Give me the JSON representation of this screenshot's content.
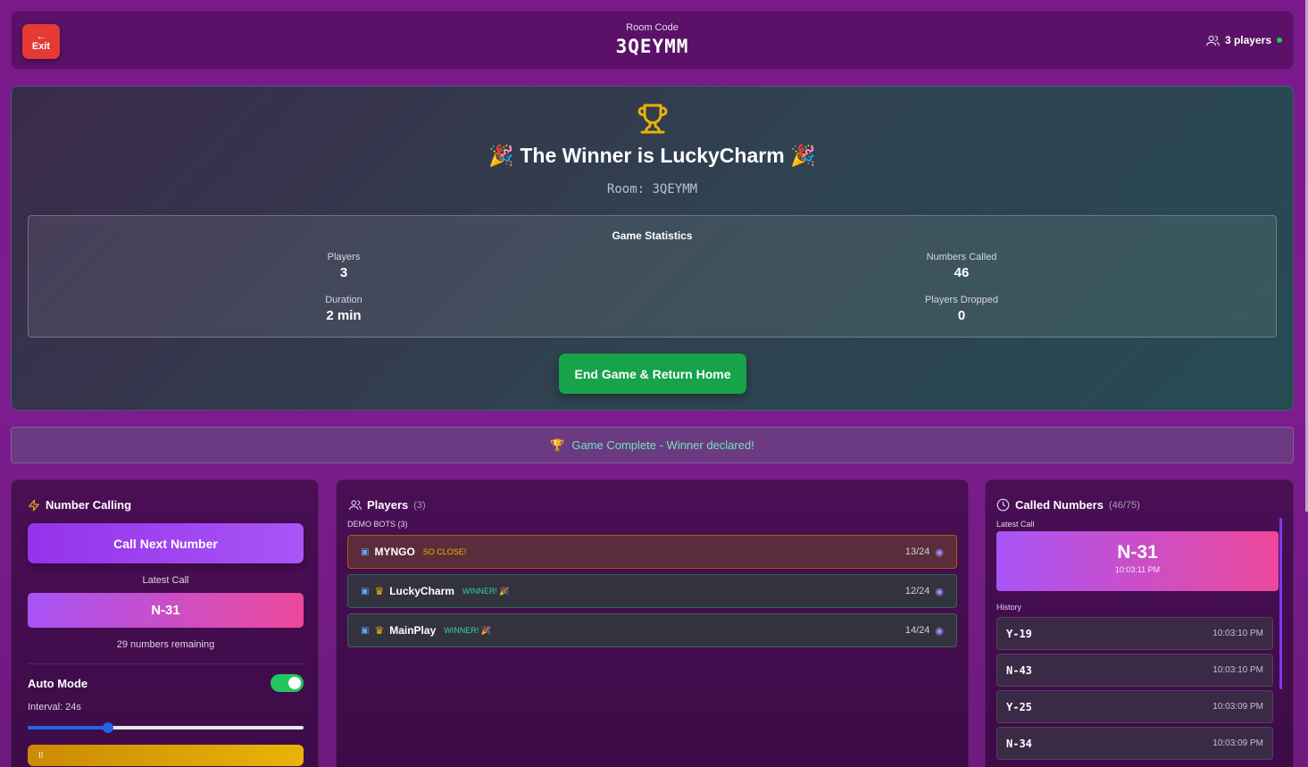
{
  "header": {
    "exit_label": "Exit",
    "room_code_label": "Room Code",
    "room_code": "3QEYMM",
    "players_label": "3 players"
  },
  "winner": {
    "title": "The Winner is LuckyCharm",
    "room_line": "Room: 3QEYMM",
    "stats_title": "Game Statistics",
    "stats": {
      "players_label": "Players",
      "players_value": "3",
      "numbers_called_label": "Numbers Called",
      "numbers_called_value": "46",
      "duration_label": "Duration",
      "duration_value": "2 min",
      "dropped_label": "Players Dropped",
      "dropped_value": "0"
    },
    "end_button": "End Game & Return Home"
  },
  "status": {
    "text": "Game Complete - Winner declared!"
  },
  "number_calling": {
    "title": "Number Calling",
    "call_button": "Call Next Number",
    "latest_label": "Latest Call",
    "latest_value": "N-31",
    "remaining": "29 numbers remaining",
    "auto_mode_label": "Auto Mode",
    "auto_mode_on": true,
    "interval_label": "Interval: 24s",
    "interval_fraction": 0.29,
    "pause_label": "II"
  },
  "players": {
    "title": "Players",
    "count": "(3)",
    "section_label": "DEMO BOTS (3)",
    "list": [
      {
        "name": "MYNGO",
        "tag": "SO CLOSE!",
        "score": "13/24"
      },
      {
        "name": "LuckyCharm",
        "tag": "WINNER! 🎉",
        "score": "12/24"
      },
      {
        "name": "MainPlay",
        "tag": "WINNER! 🎉",
        "score": "14/24"
      }
    ]
  },
  "called_numbers": {
    "title": "Called Numbers",
    "count": "(46/75)",
    "latest_label": "Latest Call",
    "latest_value": "N-31",
    "latest_time": "10:03:11 PM",
    "history_label": "History",
    "history": [
      {
        "n": "Y-19",
        "t": "10:03:10 PM"
      },
      {
        "n": "N-43",
        "t": "10:03:10 PM"
      },
      {
        "n": "Y-25",
        "t": "10:03:09 PM"
      },
      {
        "n": "N-34",
        "t": "10:03:09 PM"
      }
    ]
  },
  "colors": {
    "background": "#7a1a8c",
    "accent_purple": "#a855f7",
    "accent_pink": "#ec4899",
    "success_green": "#16a34a",
    "gold": "#eab308"
  }
}
